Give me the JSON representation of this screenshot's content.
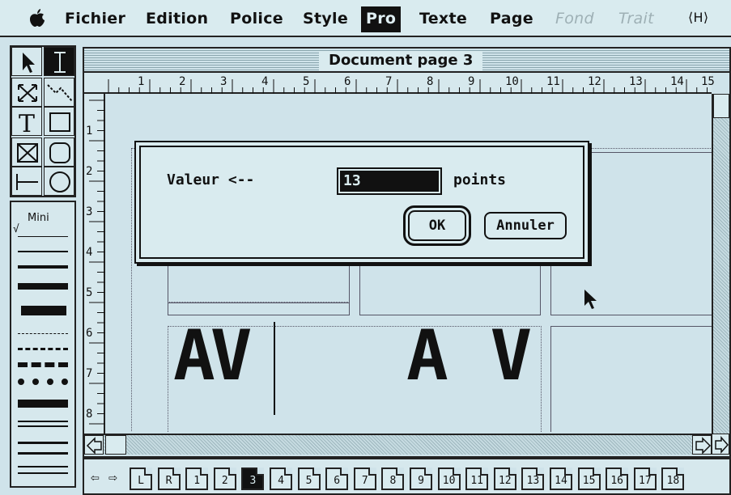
{
  "menubar": {
    "apple": "apple-icon",
    "items": [
      {
        "label": "Fichier",
        "state": "normal"
      },
      {
        "label": "Edition",
        "state": "normal"
      },
      {
        "label": "Police",
        "state": "normal"
      },
      {
        "label": "Style",
        "state": "normal"
      },
      {
        "label": "Pro",
        "state": "selected"
      },
      {
        "label": "Texte",
        "state": "normal"
      },
      {
        "label": "Page",
        "state": "normal"
      },
      {
        "label": "Fond",
        "state": "disabled"
      },
      {
        "label": "Trait",
        "state": "disabled"
      }
    ],
    "right_icon": "⟨H⟩"
  },
  "toolbox": {
    "tools": [
      "arrow-pointer-icon",
      "text-ibeam-icon",
      "resize-icon",
      "zigzag-line-icon",
      "text-tool-icon",
      "rectangle-icon",
      "image-frame-icon",
      "rounded-rectangle-icon",
      "line-tool-icon",
      "oval-icon"
    ]
  },
  "line_palette": {
    "label": "Mini",
    "check": "√"
  },
  "window": {
    "title": "Document page 3",
    "h_ruler": [
      "1",
      "2",
      "3",
      "4",
      "5",
      "6",
      "7",
      "8",
      "9",
      "10",
      "11",
      "12",
      "13",
      "14",
      "15"
    ],
    "v_ruler": [
      "1",
      "2",
      "3",
      "4",
      "5",
      "6",
      "7",
      "8"
    ]
  },
  "canvas": {
    "sample_left": "AV",
    "sample_right": "A V"
  },
  "dialog": {
    "label": "Valeur <--",
    "value": "13",
    "unit": "points",
    "ok": "OK",
    "cancel": "Annuler"
  },
  "pagebar": {
    "tabs": [
      "L",
      "R",
      "1",
      "2",
      "3",
      "4",
      "5",
      "6",
      "7",
      "8",
      "9",
      "10",
      "11",
      "12",
      "13",
      "14",
      "15",
      "16",
      "17",
      "18"
    ],
    "active": "3"
  },
  "colors": {
    "background": "#cfe3ea",
    "ink": "#111111",
    "highlight": "#111111"
  }
}
